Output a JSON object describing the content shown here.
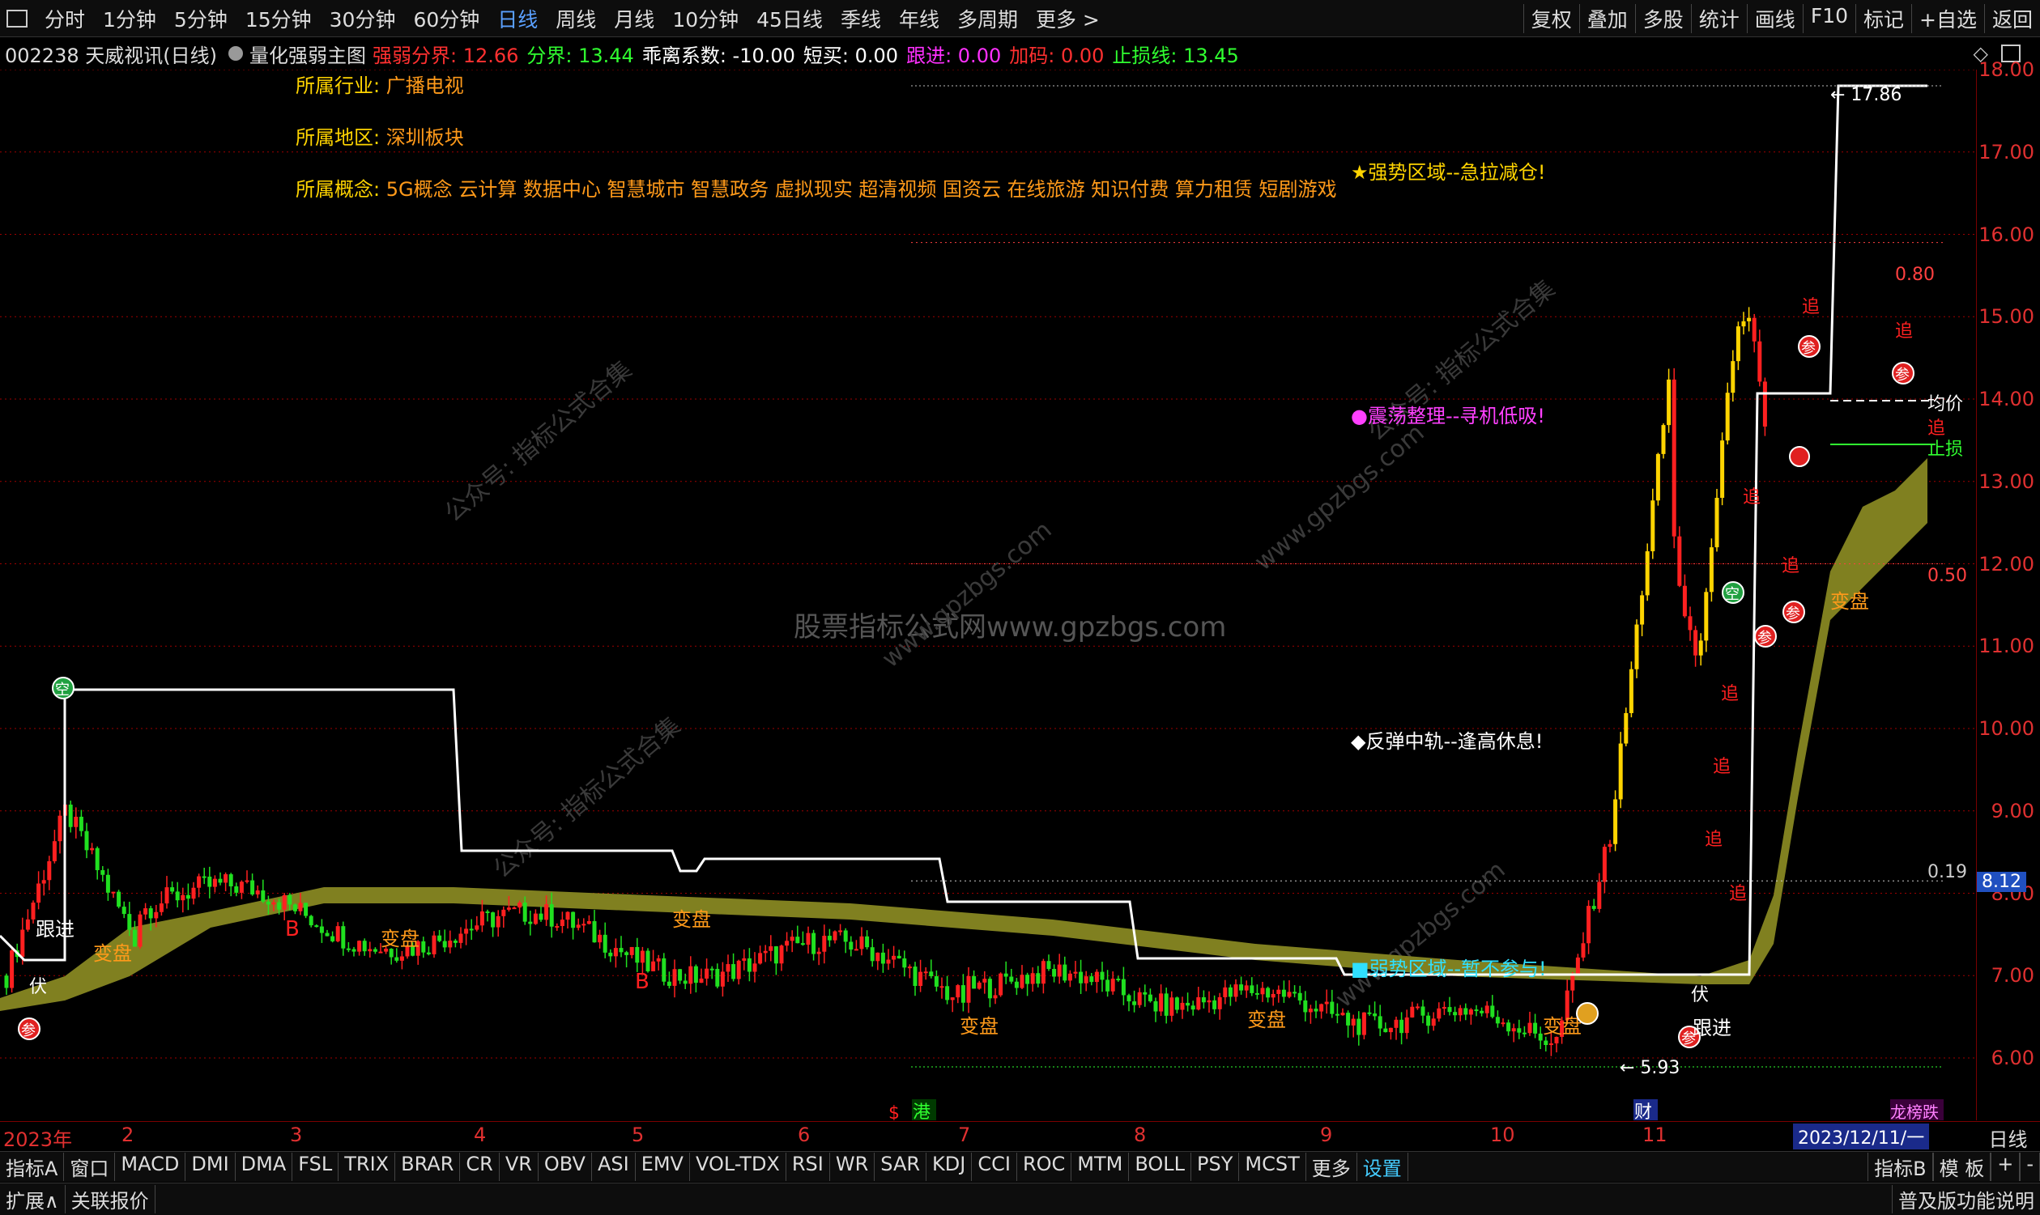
{
  "periods": [
    "分时",
    "1分钟",
    "5分钟",
    "15分钟",
    "30分钟",
    "60分钟",
    "日线",
    "周线",
    "月线",
    "10分钟",
    "45日线",
    "季线",
    "年线",
    "多周期",
    "更多 >"
  ],
  "active_period": "日线",
  "right_tools": [
    "复权",
    "叠加",
    "多股",
    "统计",
    "画线",
    "F10",
    "标记",
    "+自选",
    "返回"
  ],
  "title": {
    "code_name": "002238 天威视讯(日线)",
    "indicator": "量化强弱主图",
    "params": [
      {
        "label": "强弱分界: 12.66",
        "color": "#ff3030"
      },
      {
        "label": "分界: 13.44",
        "color": "#30ff30"
      },
      {
        "label": "乖离系数: -10.00",
        "color": "#ffffff"
      },
      {
        "label": "短买: 0.00",
        "color": "#ffffff"
      },
      {
        "label": "跟进: 0.00",
        "color": "#ff30ff"
      },
      {
        "label": "加码: 0.00",
        "color": "#ff3030"
      },
      {
        "label": "止损线: 13.45",
        "color": "#30ff30"
      }
    ]
  },
  "info": {
    "industry_label": "所属行业:",
    "industry": "广播电视",
    "region_label": "所属地区:",
    "region": "深圳板块",
    "concept_label": "所属概念:",
    "concepts": "5G概念 云计算 数据中心 智慧城市 智慧政务 虚拟现实 超清视频 国资云 在线旅游 知识付费 算力租赁 短剧游戏"
  },
  "zones": {
    "strong": "★强势区域--急拉减仓!",
    "shake": "●震荡整理--寻机低吸!",
    "rebound": "◆反弹中轨--逢高休息!",
    "weak": "■弱势区域--暂不参与!"
  },
  "watermarks": [
    "股票指标公式网www.gpzbgs.com",
    "公众号: 指标公式合集",
    "www.gpzbgs.com"
  ],
  "y_ticks": [
    "18.00",
    "17.00",
    "16.00",
    "15.00",
    "14.00",
    "13.00",
    "12.00",
    "11.00",
    "10.00",
    "9.00",
    "8.00",
    "7.00",
    "6.00"
  ],
  "price_tag": "8.12",
  "annotations": {
    "high": "17.86",
    "low": "5.93",
    "fib_080": "0.80",
    "fib_050": "0.50",
    "fib_019": "0.19",
    "avg": "均价",
    "stoploss": "止损"
  },
  "signals": {
    "kong": "空",
    "can": "参",
    "gen": "跟进",
    "zhui": "追",
    "bian": "变盘",
    "b": "B",
    "fu": "伏"
  },
  "x_labels": [
    "2023年",
    "2",
    "3",
    "4",
    "5",
    "6",
    "7",
    "8",
    "9",
    "10",
    "11"
  ],
  "date_tag": "2023/12/11/一",
  "period_button": "日线",
  "markers": {
    "s": "$",
    "gang": "港",
    "cai": "财",
    "bang": "龙榜跌"
  },
  "indicators": [
    "指标A",
    "窗口",
    "MACD",
    "DMI",
    "DMA",
    "FSL",
    "TRIX",
    "BRAR",
    "CR",
    "VR",
    "OBV",
    "ASI",
    "EMV",
    "VOL-TDX",
    "RSI",
    "WR",
    "SAR",
    "KDJ",
    "CCI",
    "ROC",
    "MTM",
    "BOLL",
    "PSY",
    "MCST",
    "更多",
    "设置"
  ],
  "ind_right": [
    "指标B",
    "模 板",
    "+",
    "-"
  ],
  "ext": {
    "expand": "扩展∧",
    "related": "关联报价",
    "right": "普及版功能说明"
  },
  "colors": {
    "up": "#ff2020",
    "down": "#20e020",
    "band": "#808020",
    "line": "#ffffff",
    "grid": "#a00000"
  }
}
